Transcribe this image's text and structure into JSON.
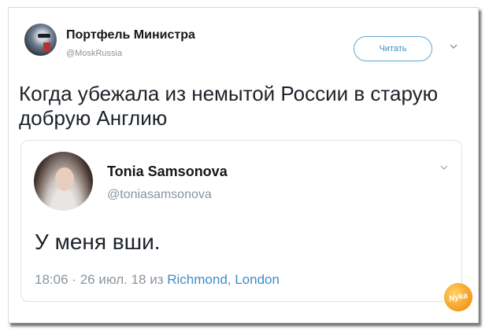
{
  "tweet": {
    "author_name": "Портфель Министра",
    "author_handle": "@MoskRussia",
    "follow_label": "Читать",
    "text": "Когда убежала из немытой России в старую добрую Англию"
  },
  "quoted_tweet": {
    "author_name": "Tonia Samsonova",
    "author_handle": "@toniasamsonova",
    "text": "У меня вши.",
    "time": "18:06",
    "separator": "·",
    "date": "26 июл. 18",
    "from_word": "из",
    "location": "Richmond, London"
  },
  "watermark": {
    "text": "Nyka"
  },
  "colors": {
    "accent": "#3a8ec7",
    "muted": "#8a949e",
    "text": "#1c2229"
  },
  "icons": {
    "menu_chevron": "chevron-down-icon"
  }
}
